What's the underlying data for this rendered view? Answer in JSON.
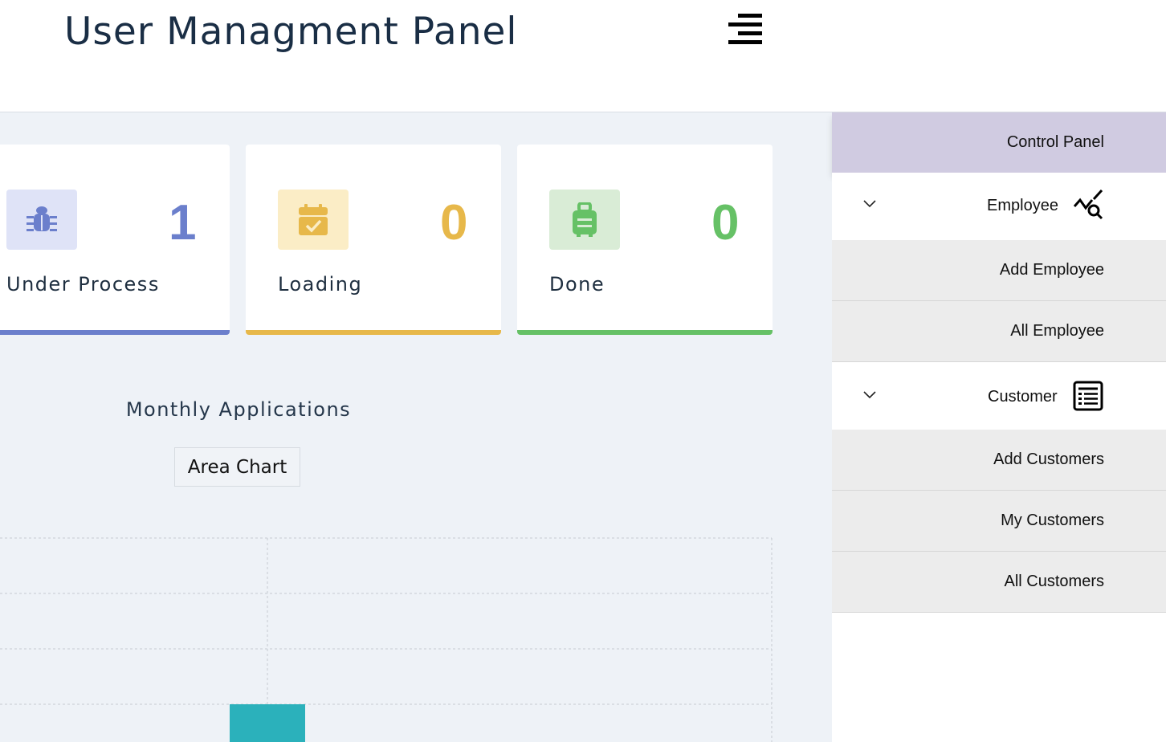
{
  "header": {
    "title": "User Managment Panel",
    "menu_icon": "menu-toggle-icon"
  },
  "stats": [
    {
      "label": "Under Process",
      "count": "1",
      "icon": "bug-icon",
      "color": "#6b7fcc",
      "bg": "#dfe3f7"
    },
    {
      "label": "Loading",
      "count": "0",
      "icon": "calendar-check-icon",
      "color": "#e7b84a",
      "bg": "#fbedc6"
    },
    {
      "label": "Done",
      "count": "0",
      "icon": "suitcase-icon",
      "color": "#66c166",
      "bg": "#d9ecd6"
    }
  ],
  "chart": {
    "title": "Monthly Applications",
    "type_button": "Area Chart",
    "series_color": "#2bb1bb",
    "grid_color": "#c5cbd2"
  },
  "chart_data": {
    "type": "bar",
    "title": "Monthly Applications",
    "grid": true,
    "values": [
      1
    ]
  },
  "sidebar": {
    "control_panel": "Control Panel",
    "employee": {
      "label": "Employee",
      "icon": "chart-search-icon",
      "items": [
        "Add Employee",
        "All Employee"
      ]
    },
    "customer": {
      "label": "Customer",
      "icon": "list-icon",
      "items": [
        "Add Customers",
        "My Customers",
        "All Customers"
      ]
    },
    "active_color": "#d0cbe1"
  }
}
